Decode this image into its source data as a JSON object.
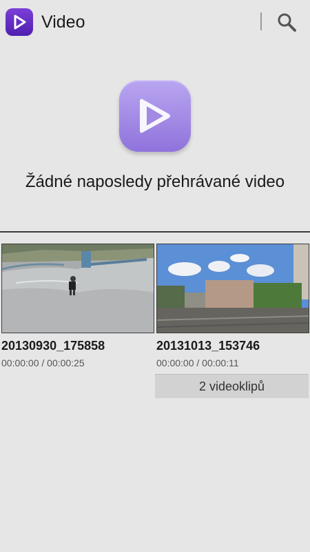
{
  "app": {
    "title": "Video"
  },
  "empty_state": {
    "message": "Žádné naposledy přehrávané video"
  },
  "videos": [
    {
      "title": "20130930_175858",
      "time": "00:00:00 / 00:00:25"
    },
    {
      "title": "20131013_153746",
      "time": "00:00:00 / 00:00:11"
    }
  ],
  "folder_button": {
    "label": "2 videoklipů"
  },
  "colors": {
    "accent": "#6a34cc",
    "hero_icon": "#a68ce6",
    "background": "#e6e6e6"
  }
}
